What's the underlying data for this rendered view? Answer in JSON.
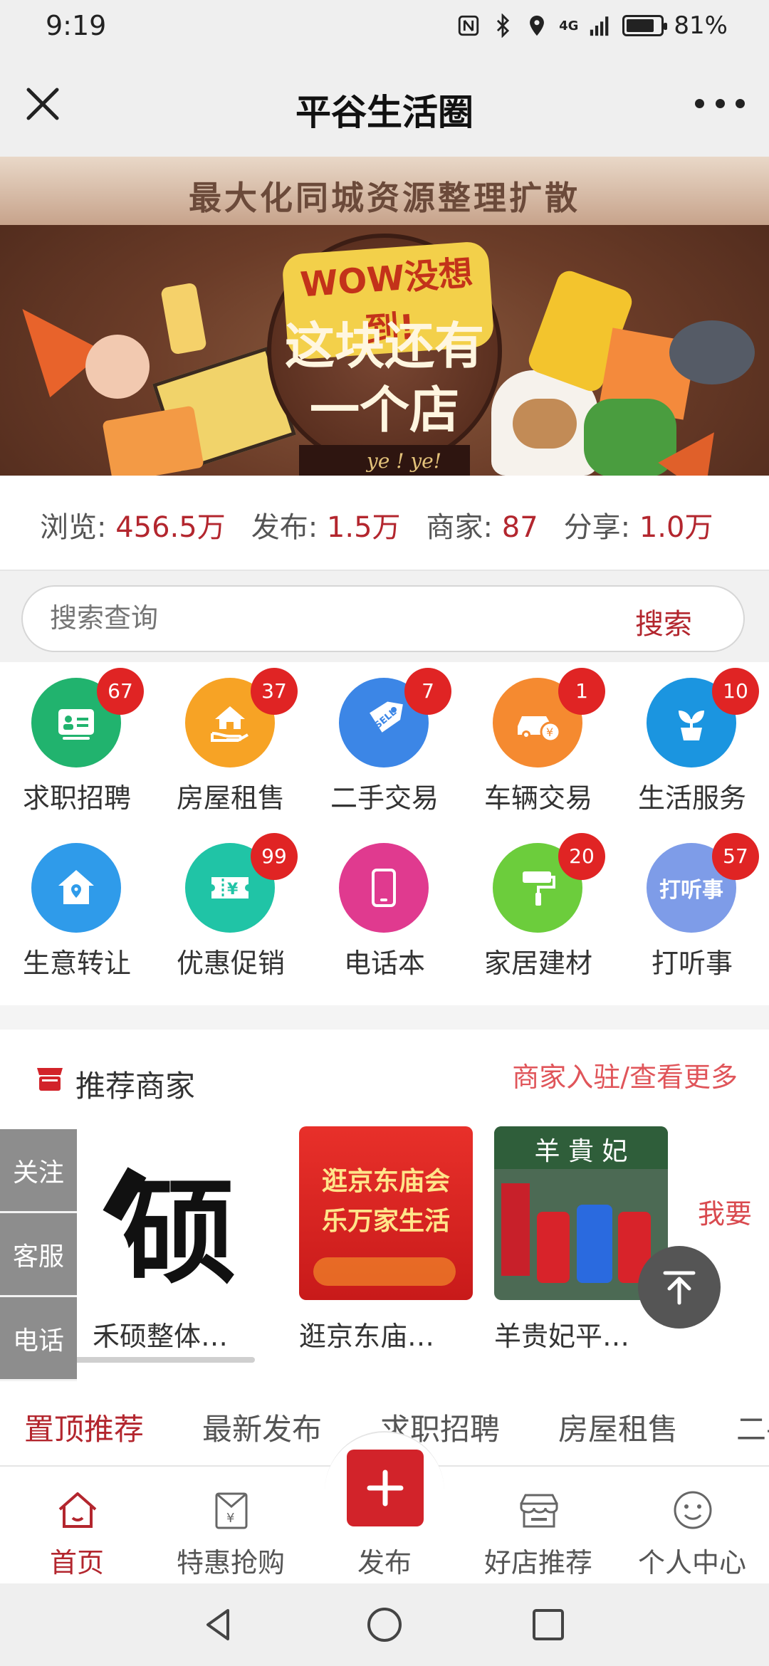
{
  "status_bar": {
    "time": "9:19",
    "battery": "81%",
    "battery_level": 0.81,
    "network_label": "4G"
  },
  "nav": {
    "title": "平谷生活圈",
    "close_icon": "close-icon",
    "more_icon": "more-icon"
  },
  "banner": {
    "headline": "最大化同城资源整理扩散",
    "wow": "WOW没想到!",
    "line1": "这块还有",
    "line2": "一个店",
    "ribbon": "ye ! ye!"
  },
  "stats": {
    "views_label": "浏览:",
    "views_value": "456.5万",
    "posts_label": "发布:",
    "posts_value": "1.5万",
    "merchants_label": "商家:",
    "merchants_value": "87",
    "shares_label": "分享:",
    "shares_value": "1.0万"
  },
  "search": {
    "placeholder": "搜索查询",
    "button_label": "搜索"
  },
  "categories": [
    {
      "label": "求职招聘",
      "badge": "67",
      "color": "#21b36e",
      "icon": "id-card-icon"
    },
    {
      "label": "房屋租售",
      "badge": "37",
      "color": "#f7a325",
      "icon": "house-hand-icon"
    },
    {
      "label": "二手交易",
      "badge": "7",
      "color": "#3c86e6",
      "icon": "sell-tag-icon"
    },
    {
      "label": "车辆交易",
      "badge": "1",
      "color": "#f58a30",
      "icon": "car-icon"
    },
    {
      "label": "生活服务",
      "badge": "10",
      "color": "#1b95e0",
      "icon": "plant-icon"
    },
    {
      "label": "生意转让",
      "badge": "",
      "color": "#2f9bea",
      "icon": "home-location-icon"
    },
    {
      "label": "优惠促销",
      "badge": "99",
      "color": "#20c4a6",
      "icon": "coupon-icon"
    },
    {
      "label": "电话本",
      "badge": "",
      "color": "#e03a8f",
      "icon": "phone-icon"
    },
    {
      "label": "家居建材",
      "badge": "20",
      "color": "#6ccd3c",
      "icon": "paint-roller-icon"
    },
    {
      "label": "打听事",
      "badge": "57",
      "color": "#7e9ce8",
      "icon": "inquire-icon",
      "icon_text": "打听事"
    }
  ],
  "recommend": {
    "title": "推荐商家",
    "more_link": "商家入驻/查看更多",
    "merchants": [
      {
        "name": "禾硕整体…",
        "logo_text": "硕"
      },
      {
        "name": "逛京东庙…",
        "poster_text": "逛京东庙会 乐万家生活"
      },
      {
        "name": "羊贵妃平…",
        "sign_text": "羊 貴 妃"
      }
    ],
    "partial_item": "我要"
  },
  "side_float": {
    "follow": "关注",
    "service": "客服",
    "phone": "电话"
  },
  "tabs": [
    "置顶推荐",
    "最新发布",
    "求职招聘",
    "房屋租售",
    "二手"
  ],
  "bottom_nav": {
    "home": "首页",
    "deals": "特惠抢购",
    "publish": "发布",
    "shops": "好店推荐",
    "profile": "个人中心"
  },
  "colors": {
    "accent": "#b3262e",
    "badge": "#e02424",
    "publish": "#d2232a"
  }
}
